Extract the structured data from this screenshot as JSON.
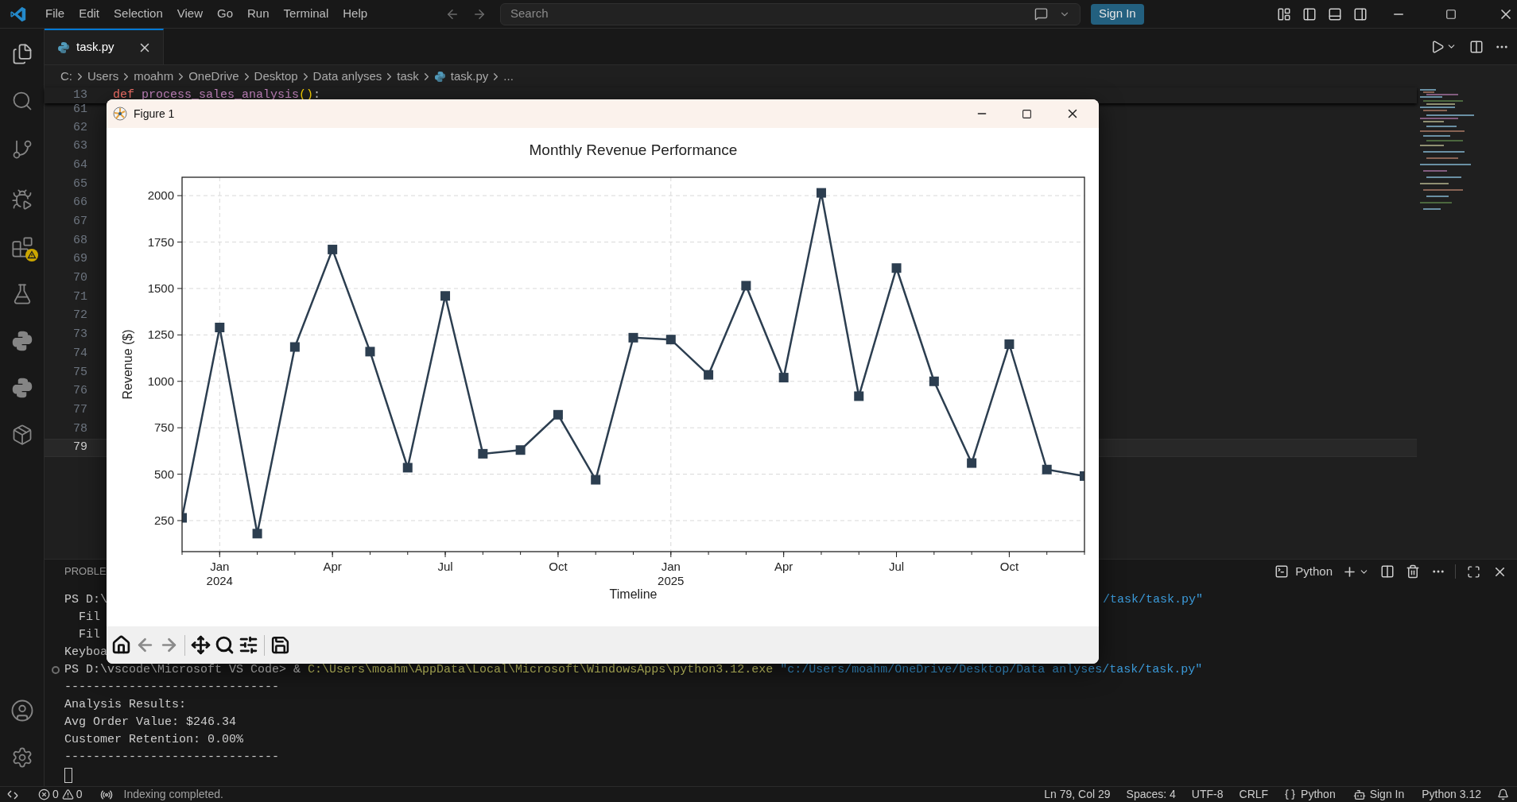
{
  "title_bar": {
    "menu": [
      "File",
      "Edit",
      "Selection",
      "View",
      "Go",
      "Run",
      "Terminal",
      "Help"
    ],
    "search": {
      "placeholder": "Search"
    },
    "sign_in": "Sign In"
  },
  "editor": {
    "tabs": [
      {
        "label": "task.py",
        "selected": true
      }
    ],
    "breadcrumbs": [
      {
        "label": "C:",
        "kind": "folder"
      },
      {
        "label": "Users",
        "kind": "folder"
      },
      {
        "label": "moahm",
        "kind": "folder"
      },
      {
        "label": "OneDrive",
        "kind": "folder"
      },
      {
        "label": "Desktop",
        "kind": "folder"
      },
      {
        "label": "Data anlyses",
        "kind": "folder"
      },
      {
        "label": "task",
        "kind": "folder"
      },
      {
        "label": "task.py",
        "kind": "file"
      },
      {
        "label": "...",
        "kind": "more"
      }
    ],
    "sticky_line": {
      "number": "13",
      "segments": [
        {
          "text": "def ",
          "kind": "keyword"
        },
        {
          "text": "process_sales_analysis",
          "kind": "function"
        },
        {
          "text": "()",
          "kind": "bracket"
        },
        {
          "text": ":",
          "kind": "plain"
        }
      ]
    },
    "lines": [
      {
        "number": "61",
        "current": false
      },
      {
        "number": "62",
        "current": false
      },
      {
        "number": "63",
        "current": false
      },
      {
        "number": "64",
        "current": false
      },
      {
        "number": "65",
        "current": false
      },
      {
        "number": "66",
        "current": false
      },
      {
        "number": "67",
        "current": false
      },
      {
        "number": "68",
        "current": false
      },
      {
        "number": "69",
        "current": false
      },
      {
        "number": "70",
        "current": false
      },
      {
        "number": "71",
        "current": false
      },
      {
        "number": "72",
        "current": false
      },
      {
        "number": "73",
        "current": false
      },
      {
        "number": "74",
        "current": false
      },
      {
        "number": "75",
        "current": false
      },
      {
        "number": "76",
        "current": false
      },
      {
        "number": "77",
        "current": false
      },
      {
        "number": "78",
        "current": false
      },
      {
        "number": "79",
        "current": true
      }
    ]
  },
  "figure": {
    "title": "Figure 1",
    "chart_data": {
      "type": "line",
      "title": "Monthly Revenue Performance",
      "xlabel": "Timeline",
      "ylabel": "Revenue ($)",
      "categories": [
        null,
        "Jan\n2024",
        null,
        null,
        "Apr",
        null,
        null,
        "Jul",
        null,
        null,
        "Oct",
        null,
        null,
        "Jan\n2025",
        null,
        null,
        "Apr",
        null,
        null,
        "Jul",
        null,
        null,
        "Oct",
        null,
        null
      ],
      "ylim": [
        83,
        2099
      ],
      "yticks": [
        250,
        500,
        750,
        1000,
        1250,
        1500,
        1750,
        2000
      ],
      "grid": true,
      "series": [
        {
          "color": "#2c3e50",
          "marker": "square",
          "values": [
            265,
            1290,
            180,
            1185,
            1710,
            1160,
            535,
            1460,
            610,
            630,
            820,
            470,
            1235,
            1225,
            1035,
            1515,
            1020,
            2015,
            920,
            1610,
            1000,
            560,
            1200,
            525,
            490
          ]
        }
      ]
    }
  },
  "panel": {
    "tab": "PROBLE",
    "profile": "Python",
    "lines": [
      {
        "kind": "text",
        "decorated": false,
        "segments": [
          {
            "text": "PS D:\\",
            "kind": "plain"
          }
        ],
        "right": {
          "text": "/task/task.py\"",
          "kind": "string"
        }
      },
      {
        "kind": "text",
        "decorated": false,
        "segments": [
          {
            "text": "  Fil",
            "kind": "plain"
          }
        ]
      },
      {
        "kind": "text",
        "decorated": false,
        "segments": [
          {
            "text": "  Fil",
            "kind": "plain"
          }
        ]
      },
      {
        "kind": "text",
        "decorated": false,
        "segments": [
          {
            "text": "Keyboa",
            "kind": "plain"
          }
        ]
      },
      {
        "kind": "text",
        "decorated": true,
        "segments": [
          {
            "text": "PS D:\\vscode\\Microsoft VS Code> & ",
            "kind": "plain"
          },
          {
            "text": "C:\\Users\\moahm\\AppData\\Local\\Microsoft\\WindowsApps\\python3.12.exe ",
            "kind": "command"
          },
          {
            "text": "\"c:/Users/moahm/OneDrive/Desktop/Data anlyses/task/task.py\"",
            "kind": "string"
          }
        ]
      },
      {
        "kind": "text",
        "decorated": false,
        "segments": [
          {
            "text": "------------------------------",
            "kind": "plain"
          }
        ]
      },
      {
        "kind": "text",
        "decorated": false,
        "segments": [
          {
            "text": "Analysis Results:",
            "kind": "plain"
          }
        ]
      },
      {
        "kind": "text",
        "decorated": false,
        "segments": [
          {
            "text": "Avg Order Value: $246.34",
            "kind": "plain"
          }
        ]
      },
      {
        "kind": "text",
        "decorated": false,
        "segments": [
          {
            "text": "Customer Retention: 0.00%",
            "kind": "plain"
          }
        ]
      },
      {
        "kind": "text",
        "decorated": false,
        "segments": [
          {
            "text": "------------------------------",
            "kind": "plain"
          }
        ]
      },
      {
        "kind": "cursor",
        "decorated": false
      }
    ]
  },
  "status_bar": {
    "left": [
      {
        "kind": "errors",
        "text": "0"
      },
      {
        "kind": "warnings",
        "text": "0"
      },
      {
        "kind": "message",
        "text": "Indexing completed."
      }
    ],
    "right": [
      {
        "kind": "text",
        "text": "Ln 79, Col 29"
      },
      {
        "kind": "text",
        "text": "Spaces: 4"
      },
      {
        "kind": "text",
        "text": "UTF-8"
      },
      {
        "kind": "text",
        "text": "CRLF"
      },
      {
        "kind": "language",
        "text": "Python"
      },
      {
        "kind": "account",
        "text": "Sign In"
      },
      {
        "kind": "text",
        "text": "Python 3.12"
      }
    ]
  }
}
